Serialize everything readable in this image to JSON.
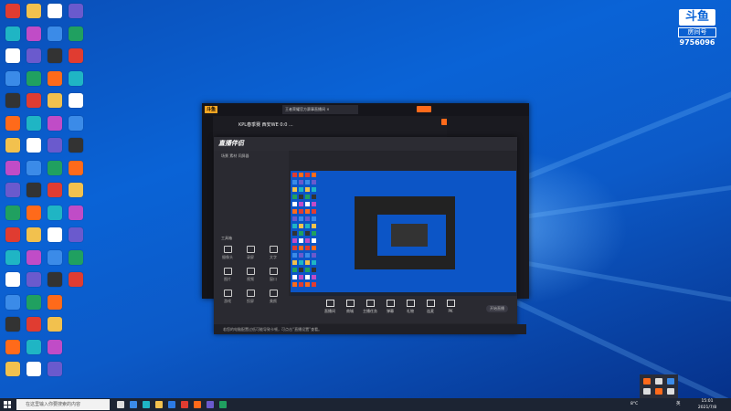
{
  "desktop": {
    "background": "#0a63d6"
  },
  "room": {
    "logo_text": "斗鱼",
    "label": "房间号",
    "number": "9756096"
  },
  "outer_window": {
    "tab_title": "王者荣耀官方赛事直播间 ×",
    "stream_title": "KPL春季赛 西安WE 0:0 ...",
    "accent": "#ff6a1a"
  },
  "inner_window": {
    "logo_text": "直播伴侣",
    "tabs": [
      "场景",
      "素材",
      "同屏器"
    ],
    "tool_label": "工具箱",
    "tools": [
      "摄像头",
      "录屏",
      "文字",
      "图片",
      "视频",
      "窗口",
      "游戏",
      "投屏",
      "美颜"
    ],
    "bottom_buttons": [
      "直播间",
      "商城",
      "主播任务",
      "弹幕",
      "礼物",
      "连麦",
      "PK"
    ],
    "start_live": "开始直播",
    "status_text": "若您的电脑配置过低可能导致卡顿，可点击“直播设置”查看。"
  },
  "taskbar": {
    "search_placeholder": "在这里输入你要搜索的内容",
    "temp": "8°C",
    "lang": "英",
    "time": "15:01",
    "date": "2021/7/8"
  }
}
